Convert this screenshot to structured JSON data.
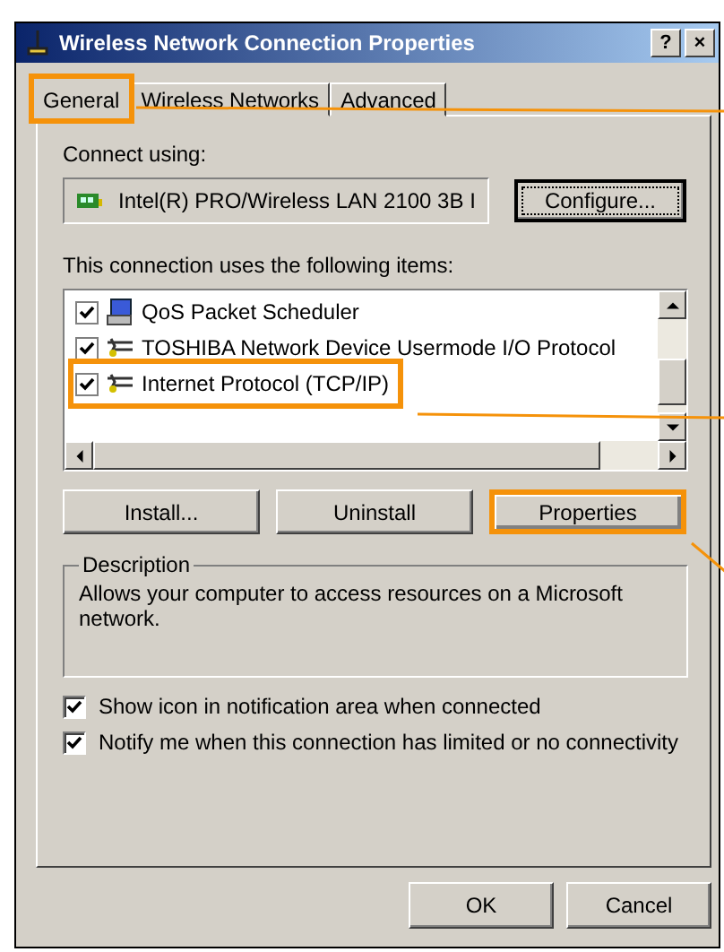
{
  "window": {
    "title": "Wireless Network Connection Properties",
    "title_buttons": [
      "?",
      "×"
    ]
  },
  "tabs": [
    {
      "label": "General",
      "selected": true,
      "highlighted": true
    },
    {
      "label": "Wireless Networks",
      "selected": false,
      "highlighted": false
    },
    {
      "label": "Advanced",
      "selected": false,
      "highlighted": false
    }
  ],
  "connect_using": {
    "label": "Connect using:",
    "adapter": "Intel(R) PRO/Wireless LAN 2100 3B I",
    "button": "Configure..."
  },
  "items_label": "This connection uses the following items:",
  "items": [
    {
      "kind": "scheduler",
      "label": "QoS Packet Scheduler",
      "checked": true,
      "highlighted": false
    },
    {
      "kind": "protocol",
      "label": "TOSHIBA Network Device Usermode I/O Protocol",
      "checked": true,
      "highlighted": false
    },
    {
      "kind": "protocol",
      "label": "Internet Protocol (TCP/IP)",
      "checked": true,
      "highlighted": true
    }
  ],
  "item_buttons": [
    {
      "label": "Install...",
      "highlighted": false
    },
    {
      "label": "Uninstall",
      "highlighted": false
    },
    {
      "label": "Properties",
      "highlighted": true
    }
  ],
  "description": {
    "title": "Description",
    "text": "Allows your computer to access resources on a Microsoft network."
  },
  "options": [
    {
      "label": "Show icon in notification area when connected",
      "checked": true
    },
    {
      "label": "Notify me when this connection has limited or no connectivity",
      "checked": true
    }
  ],
  "buttons": [
    "OK",
    "Cancel"
  ]
}
